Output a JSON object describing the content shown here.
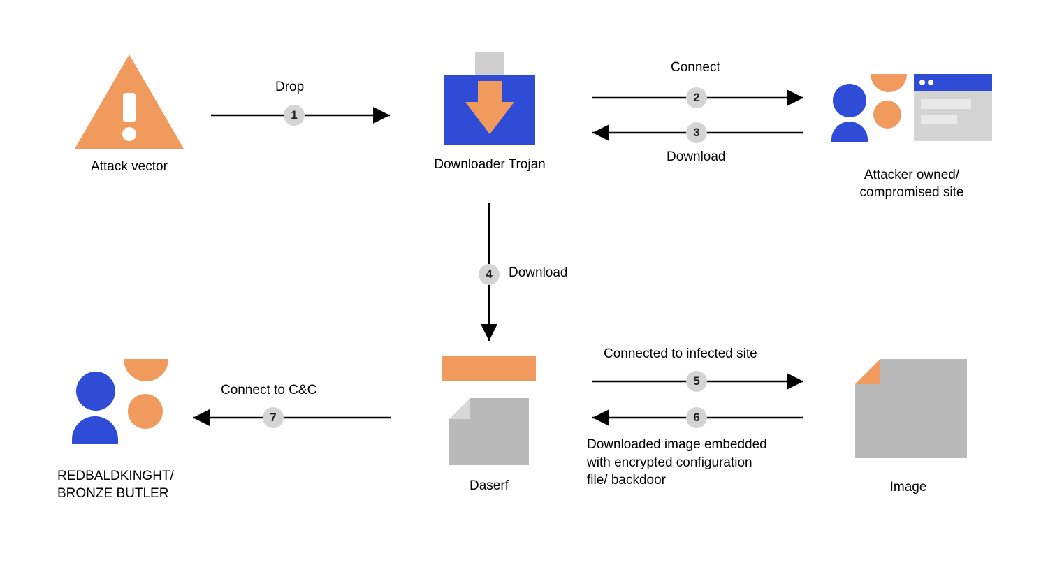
{
  "nodes": {
    "attack_vector": {
      "label": "Attack vector"
    },
    "downloader_trojan": {
      "label": "Downloader Trojan"
    },
    "attacker_site": {
      "label": "Attacker owned/\ncompromised site"
    },
    "daserf": {
      "label": "Daserf"
    },
    "image": {
      "label": "Image"
    },
    "redbaldknight": {
      "label": "REDBALDKINGHT/\nBRONZE BUTLER"
    }
  },
  "edges": {
    "e1": {
      "step": "1",
      "label": "Drop"
    },
    "e2": {
      "step": "2",
      "label": "Connect"
    },
    "e3": {
      "step": "3",
      "label": "Download"
    },
    "e4": {
      "step": "4",
      "label": "Download"
    },
    "e5": {
      "step": "5",
      "label": "Connected to infected site"
    },
    "e6": {
      "step": "6",
      "label": "Downloaded image embedded\nwith encrypted configuration\nfile/ backdoor"
    },
    "e7": {
      "step": "7",
      "label": "Connect to C&C"
    }
  },
  "colors": {
    "orange": "#f19a5e",
    "blue": "#2f4cd6",
    "gray": "#b9b9b9",
    "badge": "#d4d4d4"
  }
}
